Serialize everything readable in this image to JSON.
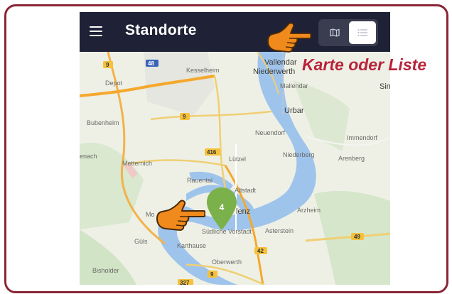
{
  "app": {
    "title": "Standorte",
    "menu_icon": "hamburger-menu-icon",
    "view_toggle": {
      "options": [
        {
          "name": "map-view",
          "icon": "map-icon",
          "selected": false
        },
        {
          "name": "list-view",
          "icon": "list-icon",
          "selected": true
        }
      ]
    }
  },
  "annotation": {
    "text": "Karte oder Liste",
    "color": "#b8233a"
  },
  "map": {
    "cluster_pin": {
      "count": "4",
      "color": "#7bb14a"
    },
    "places": {
      "vallendar": "Vallendar",
      "kesselheim": "Kesselheim",
      "niederwerth": "Niederwerth",
      "mallendar": "Mallendar",
      "depot": "Depot",
      "urbar": "Urbar",
      "sim": "Sim",
      "bubenheim": "Bubenheim",
      "neuendorf": "Neuendorf",
      "immendorf": "Immendorf",
      "niederberg": "Niederberg",
      "arenberg": "Arenberg",
      "enach": "enach",
      "metternich": "Metternich",
      "rauental": "Rauental",
      "lutzel": "Lützel",
      "altstadt": "Altstadt",
      "lenz": "lenz",
      "arzheim": "Arzheim",
      "mo": "Mo",
      "sudliche_vorstadt": "Südliche Vorstadt",
      "asterstein": "Asterstein",
      "guls": "Güls",
      "karthause": "Karthause",
      "oberwerth": "Oberwerth",
      "bisholder": "Bisholder"
    },
    "road_shields": {
      "r9a": "9",
      "r48": "48",
      "r9b": "9",
      "r416": "416",
      "r49": "49",
      "r42": "42",
      "r9c": "9",
      "r327": "327"
    }
  },
  "pointers": [
    {
      "name": "pointer-hand-icon-toggle",
      "color": "#f08a1c"
    },
    {
      "name": "pointer-hand-icon-pin",
      "color": "#f08a1c"
    }
  ]
}
